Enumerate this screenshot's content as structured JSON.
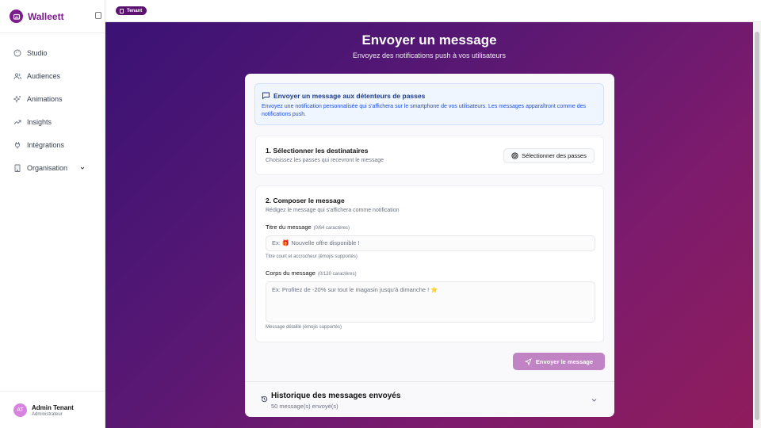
{
  "app": {
    "name": "Walleett"
  },
  "sidebar": {
    "items": [
      {
        "label": "Studio",
        "icon": "palette-icon"
      },
      {
        "label": "Audiences",
        "icon": "users-icon"
      },
      {
        "label": "Animations",
        "icon": "sparkles-icon"
      },
      {
        "label": "Insights",
        "icon": "trending-up-icon"
      },
      {
        "label": "Intégrations",
        "icon": "plug-icon"
      },
      {
        "label": "Organisation",
        "icon": "building-icon"
      }
    ]
  },
  "user": {
    "initials": "AT",
    "name": "Admin Tenant",
    "role": "Administrateur"
  },
  "topbar": {
    "badge": "Tenant"
  },
  "page": {
    "title": "Envoyer un message",
    "subtitle": "Envoyez des notifications push à vos utilisateurs"
  },
  "info": {
    "title": "Envoyer un message aux détenteurs de passes",
    "text": "Envoyez une notification personnalisée qui s'affichera sur le smartphone de vos utilisateurs. Les messages apparaîtront comme des notifications push."
  },
  "recipients": {
    "title": "1. Sélectionner les destinataires",
    "desc": "Choisissez les passes qui recevront le message",
    "button": "Sélectionner des passes"
  },
  "compose": {
    "title": "2. Composer le message",
    "desc": "Rédigez le message qui s'affichera comme notification",
    "title_label": "Titre du message",
    "title_count": "(0/64 caractères)",
    "title_placeholder": "Ex: 🎁 Nouvelle offre disponible !",
    "title_hint": "Titre court et accrocheur (émojis supportés)",
    "body_label": "Corps du message",
    "body_count": "(0/120 caractères)",
    "body_placeholder": "Ex: Profitez de -20% sur tout le magasin jusqu'à dimanche ! ⭐",
    "body_hint": "Message détaillé (émojis supportés)"
  },
  "send_button": "Envoyer le message",
  "history": {
    "title": "Historique des messages envoyés",
    "count": "50 message(s) envoyé(s)"
  },
  "colors": {
    "brand": "#7b1e8c",
    "accent": "#c083c4",
    "info_bg": "#eff6ff"
  }
}
